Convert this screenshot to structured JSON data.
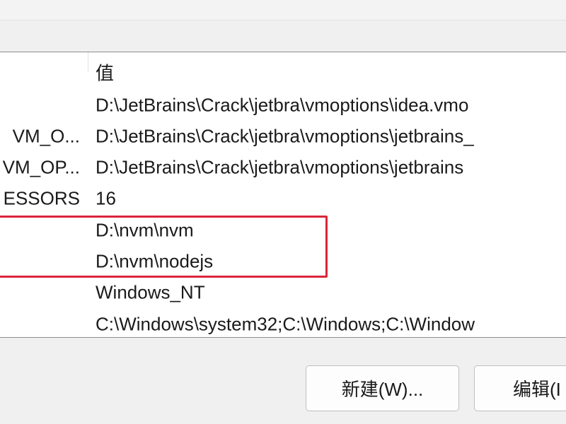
{
  "table": {
    "header": {
      "name": "",
      "value": "值"
    },
    "rows": [
      {
        "name": "",
        "value": "D:\\JetBrains\\Crack\\jetbra\\vmoptions\\idea.vmo"
      },
      {
        "name": "VM_O...",
        "value": "D:\\JetBrains\\Crack\\jetbra\\vmoptions\\jetbrains_"
      },
      {
        "name": "VM_OP...",
        "value": "D:\\JetBrains\\Crack\\jetbra\\vmoptions\\jetbrains"
      },
      {
        "name": "ESSORS",
        "value": "16"
      },
      {
        "name": "",
        "value": "D:\\nvm\\nvm"
      },
      {
        "name": "",
        "value": "D:\\nvm\\nodejs"
      },
      {
        "name": "",
        "value": "Windows_NT"
      },
      {
        "name": "",
        "value": "C:\\Windows\\system32;C:\\Windows;C:\\Window"
      }
    ]
  },
  "buttons": {
    "new_label": "新建(W)...",
    "edit_label": "编辑(I"
  },
  "colors": {
    "highlight": "#d9263b"
  }
}
